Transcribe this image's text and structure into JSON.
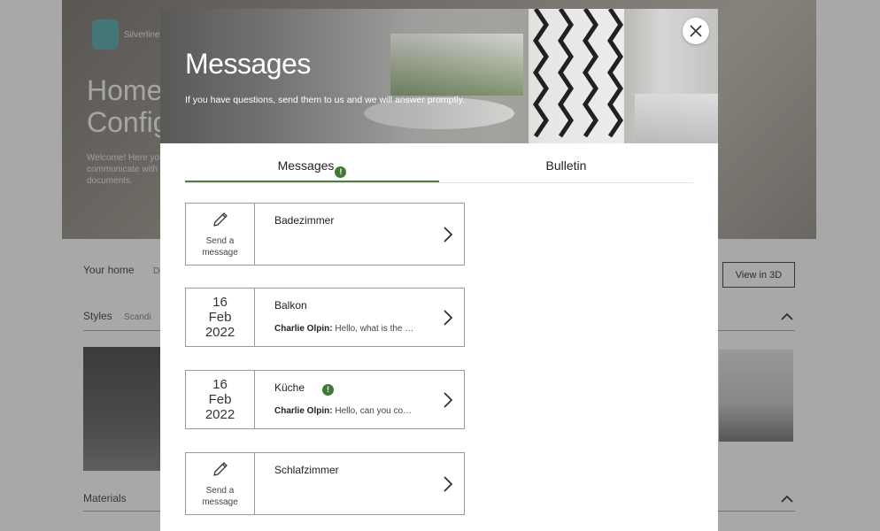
{
  "background": {
    "logo_text": "Silverline",
    "hero_title_1": "Home",
    "hero_title_2": "Config",
    "hero_text": "Welcome! Here you communicate with documents.",
    "nav_your_home": "Your home",
    "nav_second": "De",
    "view_3d_label": "View in 3D",
    "styles_label": "Styles",
    "styles_value": "Scandi",
    "materials_label": "Materials"
  },
  "modal": {
    "title": "Messages",
    "subtitle": "If you have questions, send them to us and we will answer promptly.",
    "close_icon": "close-icon"
  },
  "tabs": {
    "messages_label": "Messages",
    "messages_badge": "!",
    "bulletin_label": "Bulletin"
  },
  "cards": [
    {
      "room": "Badezimmer",
      "send_label_1": "Send a",
      "send_label_2": "message"
    },
    {
      "room": "Balkon",
      "day": "16",
      "month": "Feb",
      "year": "2022",
      "author": "Charlie Olpin:",
      "preview": "Hello, what is the …"
    },
    {
      "room": "Küche",
      "badge": "!",
      "day": "16",
      "month": "Feb",
      "year": "2022",
      "author": "Charlie Olpin:",
      "preview": "Hello, can you co…"
    },
    {
      "room": "Schlafzimmer",
      "send_label_1": "Send a",
      "send_label_2": "message"
    }
  ],
  "colors": {
    "accent_green": "#4b7f3a",
    "badge_green": "#3f7a35"
  }
}
